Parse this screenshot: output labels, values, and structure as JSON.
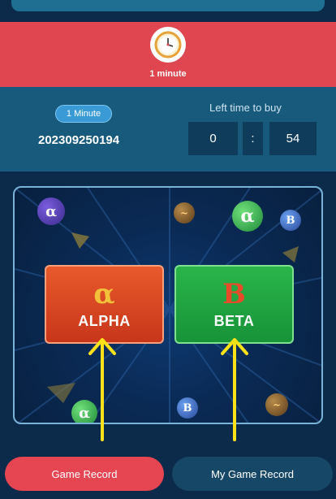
{
  "header": {
    "period_label": "1 minute",
    "clock_icon": "clock-icon"
  },
  "info": {
    "badge": "1 Minute",
    "period_number": "202309250194",
    "timer_label": "Left time to buy",
    "timer_minutes": "0",
    "timer_separator": ":",
    "timer_seconds": "54"
  },
  "options": {
    "alpha": {
      "symbol": "α",
      "label": "ALPHA",
      "color": "#d9482a"
    },
    "beta": {
      "symbol": "B",
      "label": "BETA",
      "color": "#22a843"
    }
  },
  "buttons": {
    "game_record": "Game Record",
    "my_game_record": "My Game Record"
  },
  "colors": {
    "accent_red": "#e0464f",
    "panel_blue": "#175a7c",
    "arrow_yellow": "#ffe11a"
  }
}
